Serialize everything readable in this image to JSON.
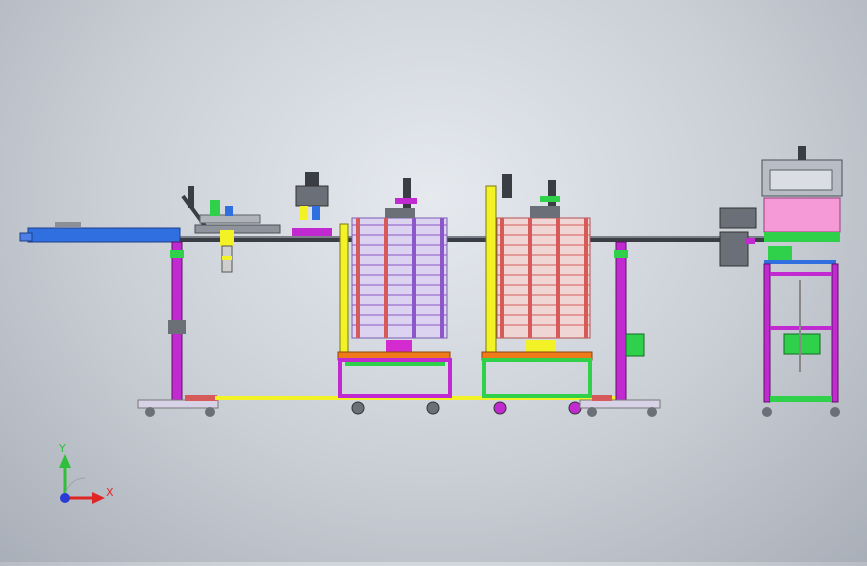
{
  "viewport": {
    "background_top": "#e6eaef",
    "background_bottom": "#a9afb8"
  },
  "colors": {
    "conveyor_blue": "#2f6fe0",
    "frame_magenta": "#c22ad1",
    "frame_green": "#2fd14a",
    "frame_yellow": "#f2f226",
    "frame_orange": "#f07a1a",
    "rail_dark": "#3a3d44",
    "pink_panel": "#f59ad6",
    "rack_red": "#d65a5a",
    "rack_purple": "#8c57c9",
    "caster_gray": "#6a6f78"
  },
  "triad": {
    "y_label": "Y",
    "x_label": "X",
    "y_color": "#2fbf3a",
    "x_color": "#e02525",
    "origin_color": "#2a3bd6"
  }
}
